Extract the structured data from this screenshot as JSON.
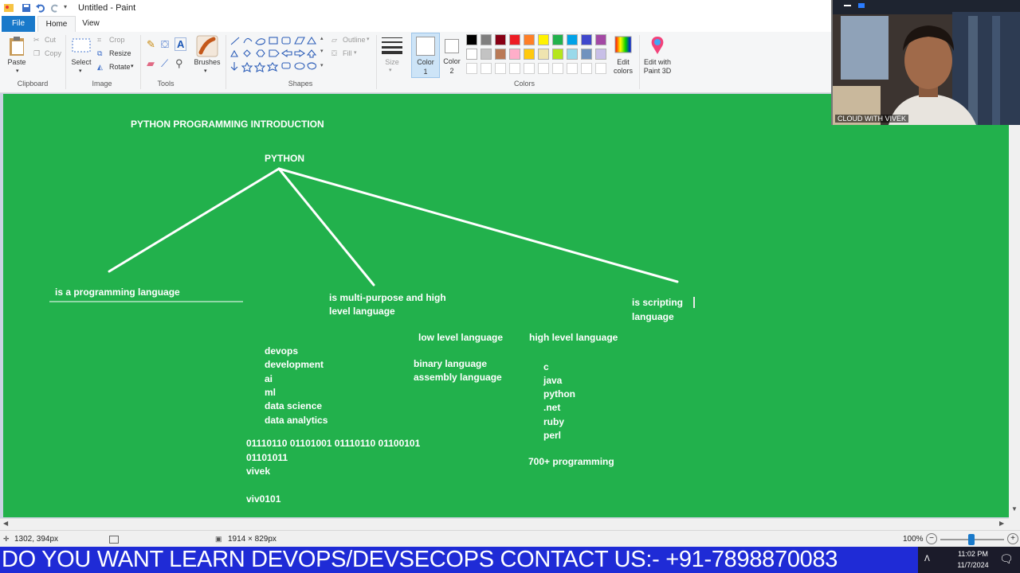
{
  "window": {
    "title": "Untitled - Paint"
  },
  "tabs": {
    "file": "File",
    "home": "Home",
    "view": "View"
  },
  "ribbon": {
    "clipboard": {
      "paste": "Paste",
      "cut": "Cut",
      "copy": "Copy",
      "label": "Clipboard"
    },
    "image": {
      "select": "Select",
      "crop": "Crop",
      "resize": "Resize",
      "rotate": "Rotate",
      "label": "Image"
    },
    "tools": {
      "label": "Tools"
    },
    "brushes": {
      "label": "Brushes"
    },
    "shapes": {
      "outline": "Outline",
      "fill": "Fill",
      "label": "Shapes"
    },
    "size": {
      "label": "Size"
    },
    "color1": {
      "label": "Color",
      "num": "1"
    },
    "color2": {
      "label": "Color",
      "num": "2"
    },
    "colors": {
      "label": "Colors",
      "edit_label": "Edit",
      "edit_label2": "colors"
    },
    "paint3d": {
      "label": "Edit with",
      "label2": "Paint 3D"
    },
    "palette_row1": [
      "#000000",
      "#7f7f7f",
      "#880015",
      "#ed1c24",
      "#ff7f27",
      "#fff200",
      "#22b14c",
      "#00a2e8",
      "#3f48cc",
      "#a349a4"
    ],
    "palette_row2": [
      "#ffffff",
      "#c3c3c3",
      "#b97a57",
      "#ffaec9",
      "#ffc90e",
      "#efe4b0",
      "#b5e61d",
      "#99d9ea",
      "#7092be",
      "#c8bfe7"
    ]
  },
  "canvas": {
    "background": "#22b14c",
    "title": "PYTHON PROGRAMMING INTRODUCTION",
    "root": "PYTHON",
    "branch1": "is a programming language",
    "branch2_line1": "is multi-purpose and high",
    "branch2_line2": "level language",
    "branch3_line1": "is scripting",
    "branch3_line2": "language",
    "uses": [
      "devops",
      "development",
      "ai",
      "ml",
      "data science",
      "data analytics"
    ],
    "low_level_title": "low level language",
    "low_level_items": [
      "binary language",
      "assembly language"
    ],
    "high_level_title": "high level language",
    "high_level_items": [
      "c",
      "java",
      "python",
      ".net",
      "ruby",
      "perl"
    ],
    "binary_line1": "01110110 01101001 01110110 01100101",
    "binary_line2": "01101011",
    "vivek": "vivek",
    "viv0101": "viv0101",
    "count_text": "700+  programming"
  },
  "status": {
    "cursor_pos": "1302, 394px",
    "canvas_size": "1914 × 829px",
    "zoom": "100%"
  },
  "banner": {
    "text": "DO YOU WANT LEARN DEVOPS/DEVSECOPS CONTACT US:- +91-7898870083"
  },
  "taskbar": {
    "time": "11:02 PM",
    "date": "11/7/2024"
  },
  "webcam": {
    "label": "CLOUD WITH VIVEK"
  }
}
